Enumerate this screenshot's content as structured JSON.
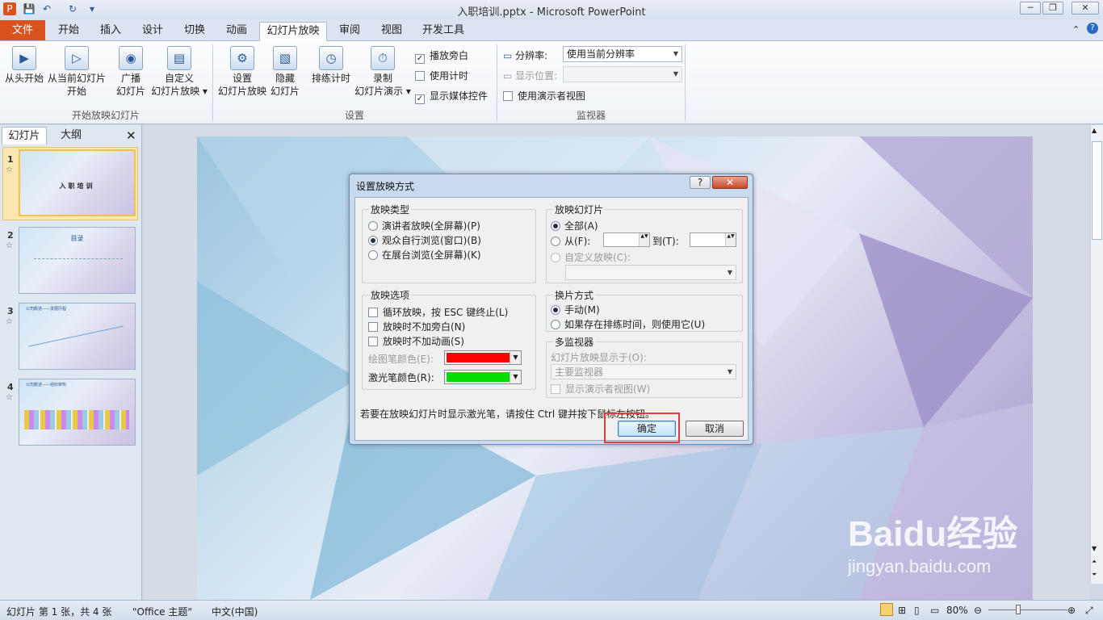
{
  "window": {
    "title": "入职培训.pptx - Microsoft PowerPoint"
  },
  "tabs": [
    "文件",
    "开始",
    "插入",
    "设计",
    "切换",
    "动画",
    "幻灯片放映",
    "审阅",
    "视图",
    "开发工具"
  ],
  "ribbon": {
    "group1": {
      "label": "开始放映幻灯片",
      "b1": "从头开始",
      "b2a": "从当前幻灯片",
      "b2b": "开始",
      "b3a": "广播",
      "b3b": "幻灯片",
      "b4a": "自定义",
      "b4b": "幻灯片放映"
    },
    "group2": {
      "label": "设置",
      "b1a": "设置",
      "b1b": "幻灯片放映",
      "b2a": "隐藏",
      "b2b": "幻灯片",
      "b3": "排练计时",
      "b4a": "录制",
      "b4b": "幻灯片演示",
      "c1": "播放旁白",
      "c2": "使用计时",
      "c3": "显示媒体控件"
    },
    "group3": {
      "label": "监视器",
      "res_label": "分辨率:",
      "res_value": "使用当前分辨率",
      "disp_label": "显示位置:",
      "presenter": "使用演示者视图"
    }
  },
  "pane": {
    "tab1": "幻灯片",
    "tab2": "大纲",
    "slides": [
      {
        "num": "1",
        "star": "☆",
        "title": "入职培训"
      },
      {
        "num": "2",
        "star": "☆",
        "title": "目录"
      },
      {
        "num": "3",
        "star": "☆",
        "title": "公司概述——发展历程"
      },
      {
        "num": "4",
        "star": "☆",
        "title": "公司概述——组织架构"
      }
    ]
  },
  "dialog": {
    "title": "设置放映方式",
    "type": {
      "legend": "放映类型",
      "o1": "演讲者放映(全屏幕)(P)",
      "o2": "观众自行浏览(窗口)(B)",
      "o3": "在展台浏览(全屏幕)(K)"
    },
    "options": {
      "legend": "放映选项",
      "c1": "循环放映，按 ESC 键终止(L)",
      "c2": "放映时不加旁白(N)",
      "c3": "放映时不加动画(S)",
      "pen": "绘图笔颜色(E):",
      "laser": "激光笔颜色(R):",
      "pen_color": "#ff0000",
      "laser_color": "#00dd00"
    },
    "slides": {
      "legend": "放映幻灯片",
      "all": "全部(A)",
      "from": "从(F):",
      "to": "到(T):",
      "custom": "自定义放映(C):"
    },
    "advance": {
      "legend": "换片方式",
      "manual": "手动(M)",
      "timing": "如果存在排练时间，则使用它(U)"
    },
    "monitors": {
      "legend": "多监视器",
      "show_on": "幻灯片放映显示于(O):",
      "monitor": "主要监视器",
      "presenter": "显示演示者视图(W)"
    },
    "hint": "若要在放映幻灯片时显示激光笔，请按住 Ctrl 键并按下鼠标左按钮。",
    "ok": "确定",
    "cancel": "取消",
    "help": "?",
    "close": "✕"
  },
  "status": {
    "slide": "幻灯片 第 1 张，共 4 张",
    "theme": "\"Office 主题\"",
    "lang": "中文(中国)",
    "zoom": "80%"
  },
  "watermark": {
    "brand": "Baidu经验",
    "url": "jingyan.baidu.com"
  }
}
